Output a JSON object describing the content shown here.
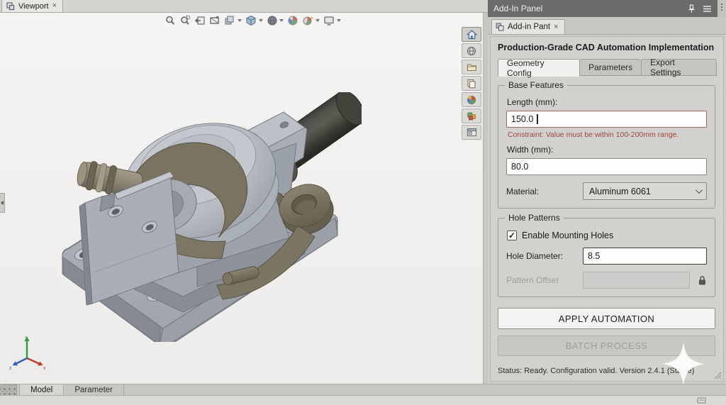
{
  "viewport": {
    "tab": {
      "label": "Viewport",
      "close": "×"
    },
    "hud_toolbar": {
      "icons": [
        {
          "name": "zoom-fit-icon",
          "caret": false
        },
        {
          "name": "zoom-area-icon",
          "caret": false
        },
        {
          "name": "previous-view-icon",
          "caret": false
        },
        {
          "name": "section-view-icon",
          "caret": false
        },
        {
          "name": "view-orientation-icon",
          "caret": true
        },
        {
          "name": "isometric-cube-icon",
          "caret": true
        },
        {
          "name": "display-style-icon",
          "caret": true
        },
        {
          "name": "edit-appearance-icon",
          "caret": false
        },
        {
          "name": "apply-scene-icon",
          "caret": true
        },
        {
          "name": "view-settings-icon",
          "caret": true
        }
      ]
    },
    "side_toolbar": {
      "icons": [
        "home-icon",
        "globe-icon",
        "folder-icon",
        "copy-pages-icon",
        "pie-chart-icon",
        "palette-icon",
        "window-layout-icon"
      ]
    },
    "triad": {
      "x_label": "x",
      "y_label": "y",
      "z_label": "z"
    },
    "model_name": "cad-assembly-clamp"
  },
  "bottom_bar": {
    "tabs": [
      {
        "label": "Model",
        "active": true
      },
      {
        "label": "Parameter",
        "active": false
      }
    ]
  },
  "panel": {
    "titlebar": {
      "title": "Add-In Panel"
    },
    "doc_tab": {
      "label": "Add-in Pant",
      "close": "×"
    },
    "heading": "Production-Grade CAD Automation Implementation",
    "tabs": [
      {
        "label": "Geometry Config",
        "active": true
      },
      {
        "label": "Parameters",
        "active": false
      },
      {
        "label": "Export Settings",
        "active": false
      }
    ],
    "base_features": {
      "title": "Base Features",
      "length_label": "Length (mm):",
      "length_value": "150.0",
      "constraint": "Constraint: Value must be within 100-200mm range.",
      "width_label": "Width (mm):",
      "width_value": "80.0",
      "material_label": "Material:",
      "material_value": "Aluminum 6061"
    },
    "hole_patterns": {
      "title": "Hole Patterns",
      "checkbox_label": "Enable Mounting Holes",
      "checkbox_checked": true,
      "check_glyph": "✓",
      "hole_diameter_label": "Hole Diameter:",
      "hole_diameter_value": "8.5",
      "pattern_offset_label": "Pattern Offset",
      "pattern_offset_value": ""
    },
    "buttons": {
      "apply": "APPLY AUTOMATION",
      "batch": "BATCH PROCESS"
    },
    "status": "Status: Ready. Configuration valid. Version 2.4.1 (Stable)"
  },
  "colors": {
    "titlebar_bg": "#6b6b6b",
    "panel_bg": "#d3d1ce",
    "error_text": "#9c4540",
    "error_border": "#a5655f",
    "active_tab_bg": "#f1f0ee",
    "viewport_bg": "#f3f2f0",
    "metal_gray": "#a5aab2",
    "dark_cylinder": "#44443d",
    "olive_part": "#7b7563",
    "triad_x": "#c0392b",
    "triad_y": "#2e9e3e",
    "triad_z": "#2b5fc0"
  }
}
